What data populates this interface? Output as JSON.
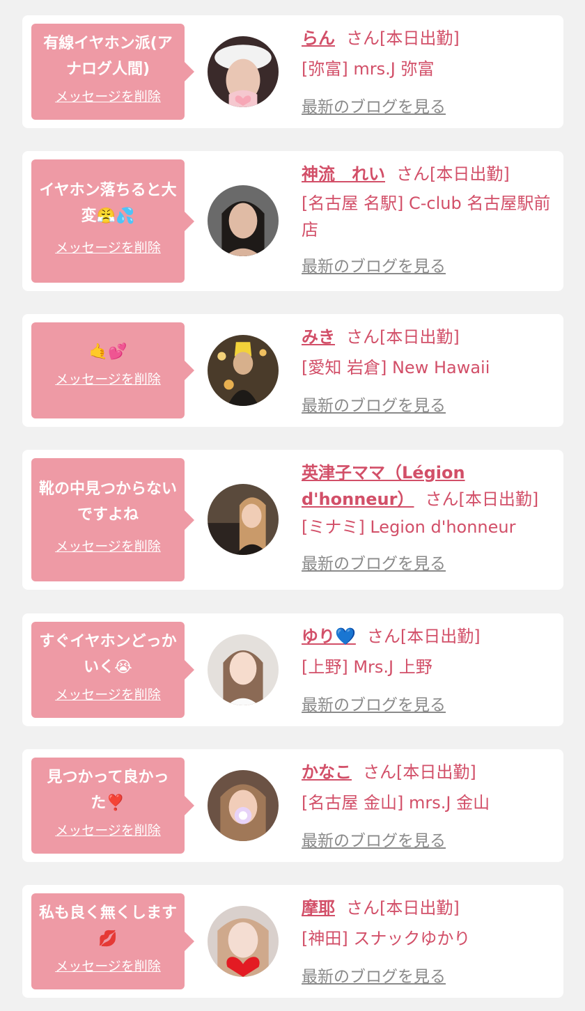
{
  "entries": [
    {
      "message": "有線イヤホン派(アナログ人間)",
      "delete_label": "メッセージを削除",
      "name": "らん",
      "suffix": "さん[本日出勤]",
      "shop": "[弥富] mrs.J 弥富",
      "blog_label": "最新のブログを見る"
    },
    {
      "message": "イヤホン落ちると大変😤💦",
      "delete_label": "メッセージを削除",
      "name": "神流　れい",
      "suffix": "さん[本日出勤]",
      "shop": "[名古屋 名駅] C-club 名古屋駅前店",
      "blog_label": "最新のブログを見る"
    },
    {
      "message": "🤙💕",
      "delete_label": "メッセージを削除",
      "name": "みき",
      "suffix": "さん[本日出勤]",
      "shop": "[愛知 岩倉] New Hawaii",
      "blog_label": "最新のブログを見る"
    },
    {
      "message": "靴の中見つからないですよね",
      "delete_label": "メッセージを削除",
      "name": "英津子ママ（Légion d'honneur）",
      "suffix": "さん[本日出勤]",
      "shop": "[ミナミ] Legion d'honneur",
      "blog_label": "最新のブログを見る"
    },
    {
      "message": "すぐイヤホンどっかいく😭",
      "delete_label": "メッセージを削除",
      "name": "ゆり💙",
      "suffix": "さん[本日出勤]",
      "shop": "[上野] Mrs.J 上野",
      "blog_label": "最新のブログを見る"
    },
    {
      "message": "見つかって良かった❣️",
      "delete_label": "メッセージを削除",
      "name": "かなこ",
      "suffix": "さん[本日出勤]",
      "shop": "[名古屋 金山] mrs.J 金山",
      "blog_label": "最新のブログを見る"
    },
    {
      "message": "私も良く無くします💋",
      "delete_label": "メッセージを削除",
      "name": "摩耶",
      "suffix": "さん[本日出勤]",
      "shop": "[神田] スナックゆかり",
      "blog_label": "最新のブログを見る"
    }
  ],
  "colors": {
    "page_bg": "#f1f1f1",
    "card_bg": "#ffffff",
    "bubble_bg": "#ee9aa5",
    "accent": "#d24f68",
    "link_gray": "#8a8a8a"
  },
  "icons": {
    "avatar": "profile-photo"
  }
}
